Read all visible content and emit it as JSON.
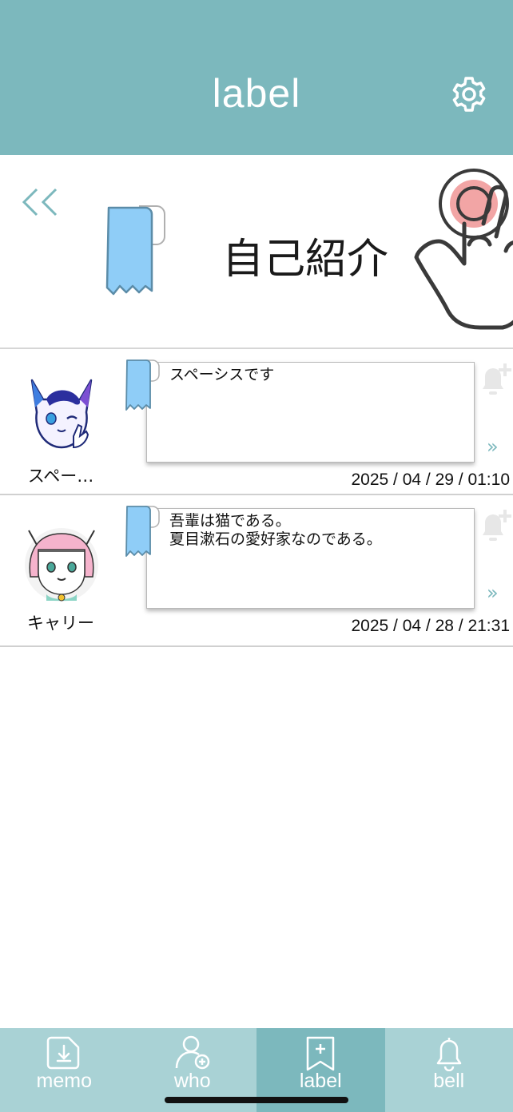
{
  "header": {
    "title": "label",
    "settings_icon": "gear-icon"
  },
  "label": {
    "name": "自己紹介",
    "back_icon": "chevron-double-left-icon",
    "tag_icon": "label-tag-icon",
    "tap_icon": "tap-hand-icon"
  },
  "memos": [
    {
      "user": "スペー…",
      "text": "スペーシスです",
      "timestamp": "2025 / 04 / 29 / 01:10",
      "more": "»"
    },
    {
      "user": "キャリー",
      "text": "吾輩は猫である。\n夏目漱石の愛好家なのである。",
      "timestamp": "2025 / 04 / 28 / 21:31",
      "more": "»"
    }
  ],
  "tabs": [
    {
      "label": "memo",
      "icon": "memo-download-icon",
      "active": false
    },
    {
      "label": "who",
      "icon": "user-add-icon",
      "active": false
    },
    {
      "label": "label",
      "icon": "label-add-icon",
      "active": true
    },
    {
      "label": "bell",
      "icon": "bell-icon",
      "active": false
    }
  ],
  "colors": {
    "teal": "#7cb8bd",
    "teal_light": "#a9d2d5",
    "tag_blue": "#8fcdf7"
  }
}
